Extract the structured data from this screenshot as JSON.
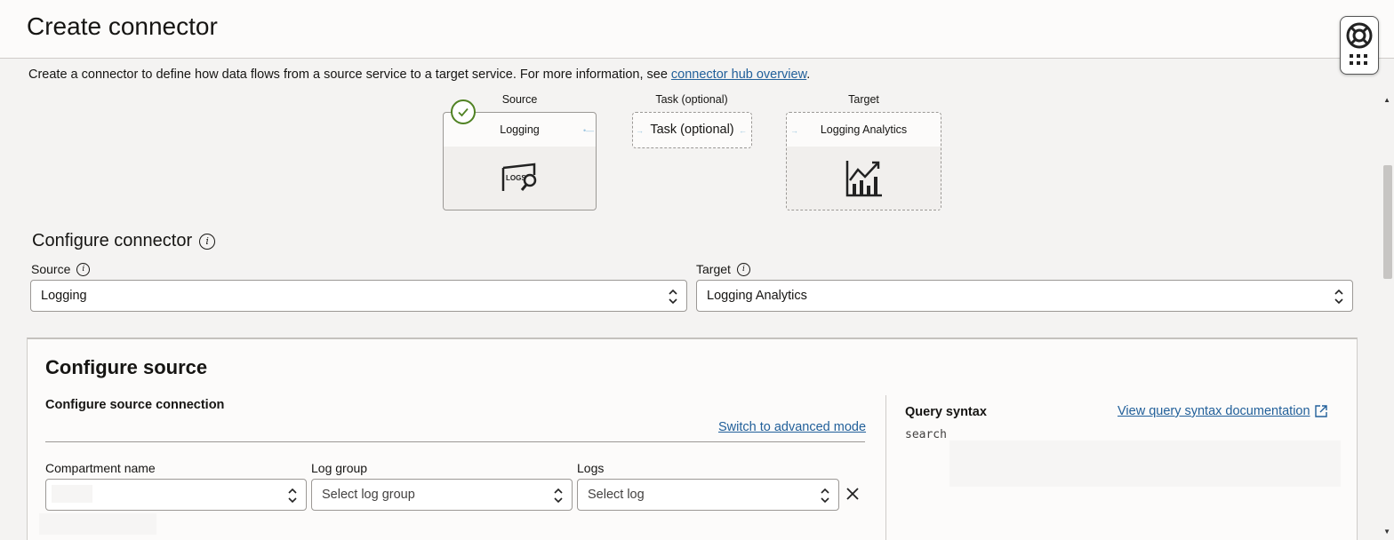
{
  "header": {
    "title": "Create connector"
  },
  "intro": {
    "text": "Create a connector to define how data flows from a source service to a target service. For more information, see ",
    "link": "connector hub overview",
    "suffix": "."
  },
  "flow": {
    "source_label": "Source",
    "source_card": "Logging",
    "source_icon": "logs-search-icon",
    "task_label": "Task (optional)",
    "task_card": "Task (optional)",
    "target_label": "Target",
    "target_card": "Logging Analytics",
    "target_icon": "analytics-chart-icon"
  },
  "configure_connector": {
    "title": "Configure connector",
    "source_label": "Source",
    "source_value": "Logging",
    "target_label": "Target",
    "target_value": "Logging Analytics"
  },
  "configure_source": {
    "title": "Configure source",
    "connection_title": "Configure source connection",
    "advanced_link": "Switch to advanced mode",
    "compartment_label": "Compartment name",
    "compartment_value": "",
    "log_group_label": "Log group",
    "log_group_value": "Select log group",
    "logs_label": "Logs",
    "logs_value": "Select log",
    "query_title": "Query syntax",
    "query_doc_link": "View query syntax documentation",
    "query_text": "search"
  },
  "colors": {
    "link": "#22609a",
    "success": "#508223",
    "page_bg": "#f4f3f2",
    "panel_bg": "#fcfbfa"
  }
}
